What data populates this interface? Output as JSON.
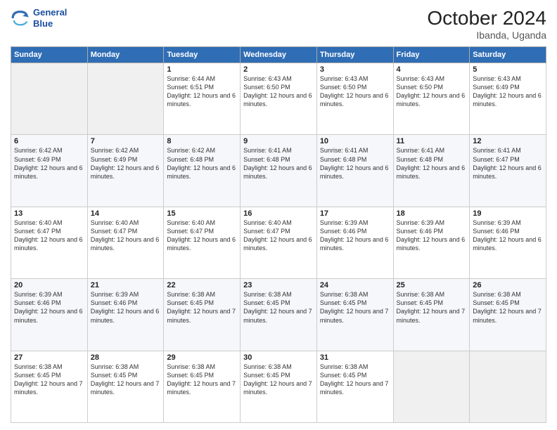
{
  "logo": {
    "line1": "General",
    "line2": "Blue"
  },
  "title": "October 2024",
  "subtitle": "Ibanda, Uganda",
  "weekdays": [
    "Sunday",
    "Monday",
    "Tuesday",
    "Wednesday",
    "Thursday",
    "Friday",
    "Saturday"
  ],
  "weeks": [
    [
      {
        "day": "",
        "empty": true
      },
      {
        "day": "",
        "empty": true
      },
      {
        "day": "1",
        "sunrise": "6:44 AM",
        "sunset": "6:51 PM",
        "daylight": "Daylight: 12 hours and 6 minutes."
      },
      {
        "day": "2",
        "sunrise": "6:43 AM",
        "sunset": "6:50 PM",
        "daylight": "Daylight: 12 hours and 6 minutes."
      },
      {
        "day": "3",
        "sunrise": "6:43 AM",
        "sunset": "6:50 PM",
        "daylight": "Daylight: 12 hours and 6 minutes."
      },
      {
        "day": "4",
        "sunrise": "6:43 AM",
        "sunset": "6:50 PM",
        "daylight": "Daylight: 12 hours and 6 minutes."
      },
      {
        "day": "5",
        "sunrise": "6:43 AM",
        "sunset": "6:49 PM",
        "daylight": "Daylight: 12 hours and 6 minutes."
      }
    ],
    [
      {
        "day": "6",
        "sunrise": "6:42 AM",
        "sunset": "6:49 PM",
        "daylight": "Daylight: 12 hours and 6 minutes."
      },
      {
        "day": "7",
        "sunrise": "6:42 AM",
        "sunset": "6:49 PM",
        "daylight": "Daylight: 12 hours and 6 minutes."
      },
      {
        "day": "8",
        "sunrise": "6:42 AM",
        "sunset": "6:48 PM",
        "daylight": "Daylight: 12 hours and 6 minutes."
      },
      {
        "day": "9",
        "sunrise": "6:41 AM",
        "sunset": "6:48 PM",
        "daylight": "Daylight: 12 hours and 6 minutes."
      },
      {
        "day": "10",
        "sunrise": "6:41 AM",
        "sunset": "6:48 PM",
        "daylight": "Daylight: 12 hours and 6 minutes."
      },
      {
        "day": "11",
        "sunrise": "6:41 AM",
        "sunset": "6:48 PM",
        "daylight": "Daylight: 12 hours and 6 minutes."
      },
      {
        "day": "12",
        "sunrise": "6:41 AM",
        "sunset": "6:47 PM",
        "daylight": "Daylight: 12 hours and 6 minutes."
      }
    ],
    [
      {
        "day": "13",
        "sunrise": "6:40 AM",
        "sunset": "6:47 PM",
        "daylight": "Daylight: 12 hours and 6 minutes."
      },
      {
        "day": "14",
        "sunrise": "6:40 AM",
        "sunset": "6:47 PM",
        "daylight": "Daylight: 12 hours and 6 minutes."
      },
      {
        "day": "15",
        "sunrise": "6:40 AM",
        "sunset": "6:47 PM",
        "daylight": "Daylight: 12 hours and 6 minutes."
      },
      {
        "day": "16",
        "sunrise": "6:40 AM",
        "sunset": "6:47 PM",
        "daylight": "Daylight: 12 hours and 6 minutes."
      },
      {
        "day": "17",
        "sunrise": "6:39 AM",
        "sunset": "6:46 PM",
        "daylight": "Daylight: 12 hours and 6 minutes."
      },
      {
        "day": "18",
        "sunrise": "6:39 AM",
        "sunset": "6:46 PM",
        "daylight": "Daylight: 12 hours and 6 minutes."
      },
      {
        "day": "19",
        "sunrise": "6:39 AM",
        "sunset": "6:46 PM",
        "daylight": "Daylight: 12 hours and 6 minutes."
      }
    ],
    [
      {
        "day": "20",
        "sunrise": "6:39 AM",
        "sunset": "6:46 PM",
        "daylight": "Daylight: 12 hours and 6 minutes."
      },
      {
        "day": "21",
        "sunrise": "6:39 AM",
        "sunset": "6:46 PM",
        "daylight": "Daylight: 12 hours and 6 minutes."
      },
      {
        "day": "22",
        "sunrise": "6:38 AM",
        "sunset": "6:45 PM",
        "daylight": "Daylight: 12 hours and 7 minutes."
      },
      {
        "day": "23",
        "sunrise": "6:38 AM",
        "sunset": "6:45 PM",
        "daylight": "Daylight: 12 hours and 7 minutes."
      },
      {
        "day": "24",
        "sunrise": "6:38 AM",
        "sunset": "6:45 PM",
        "daylight": "Daylight: 12 hours and 7 minutes."
      },
      {
        "day": "25",
        "sunrise": "6:38 AM",
        "sunset": "6:45 PM",
        "daylight": "Daylight: 12 hours and 7 minutes."
      },
      {
        "day": "26",
        "sunrise": "6:38 AM",
        "sunset": "6:45 PM",
        "daylight": "Daylight: 12 hours and 7 minutes."
      }
    ],
    [
      {
        "day": "27",
        "sunrise": "6:38 AM",
        "sunset": "6:45 PM",
        "daylight": "Daylight: 12 hours and 7 minutes."
      },
      {
        "day": "28",
        "sunrise": "6:38 AM",
        "sunset": "6:45 PM",
        "daylight": "Daylight: 12 hours and 7 minutes."
      },
      {
        "day": "29",
        "sunrise": "6:38 AM",
        "sunset": "6:45 PM",
        "daylight": "Daylight: 12 hours and 7 minutes."
      },
      {
        "day": "30",
        "sunrise": "6:38 AM",
        "sunset": "6:45 PM",
        "daylight": "Daylight: 12 hours and 7 minutes."
      },
      {
        "day": "31",
        "sunrise": "6:38 AM",
        "sunset": "6:45 PM",
        "daylight": "Daylight: 12 hours and 7 minutes."
      },
      {
        "day": "",
        "empty": true
      },
      {
        "day": "",
        "empty": true
      }
    ]
  ]
}
